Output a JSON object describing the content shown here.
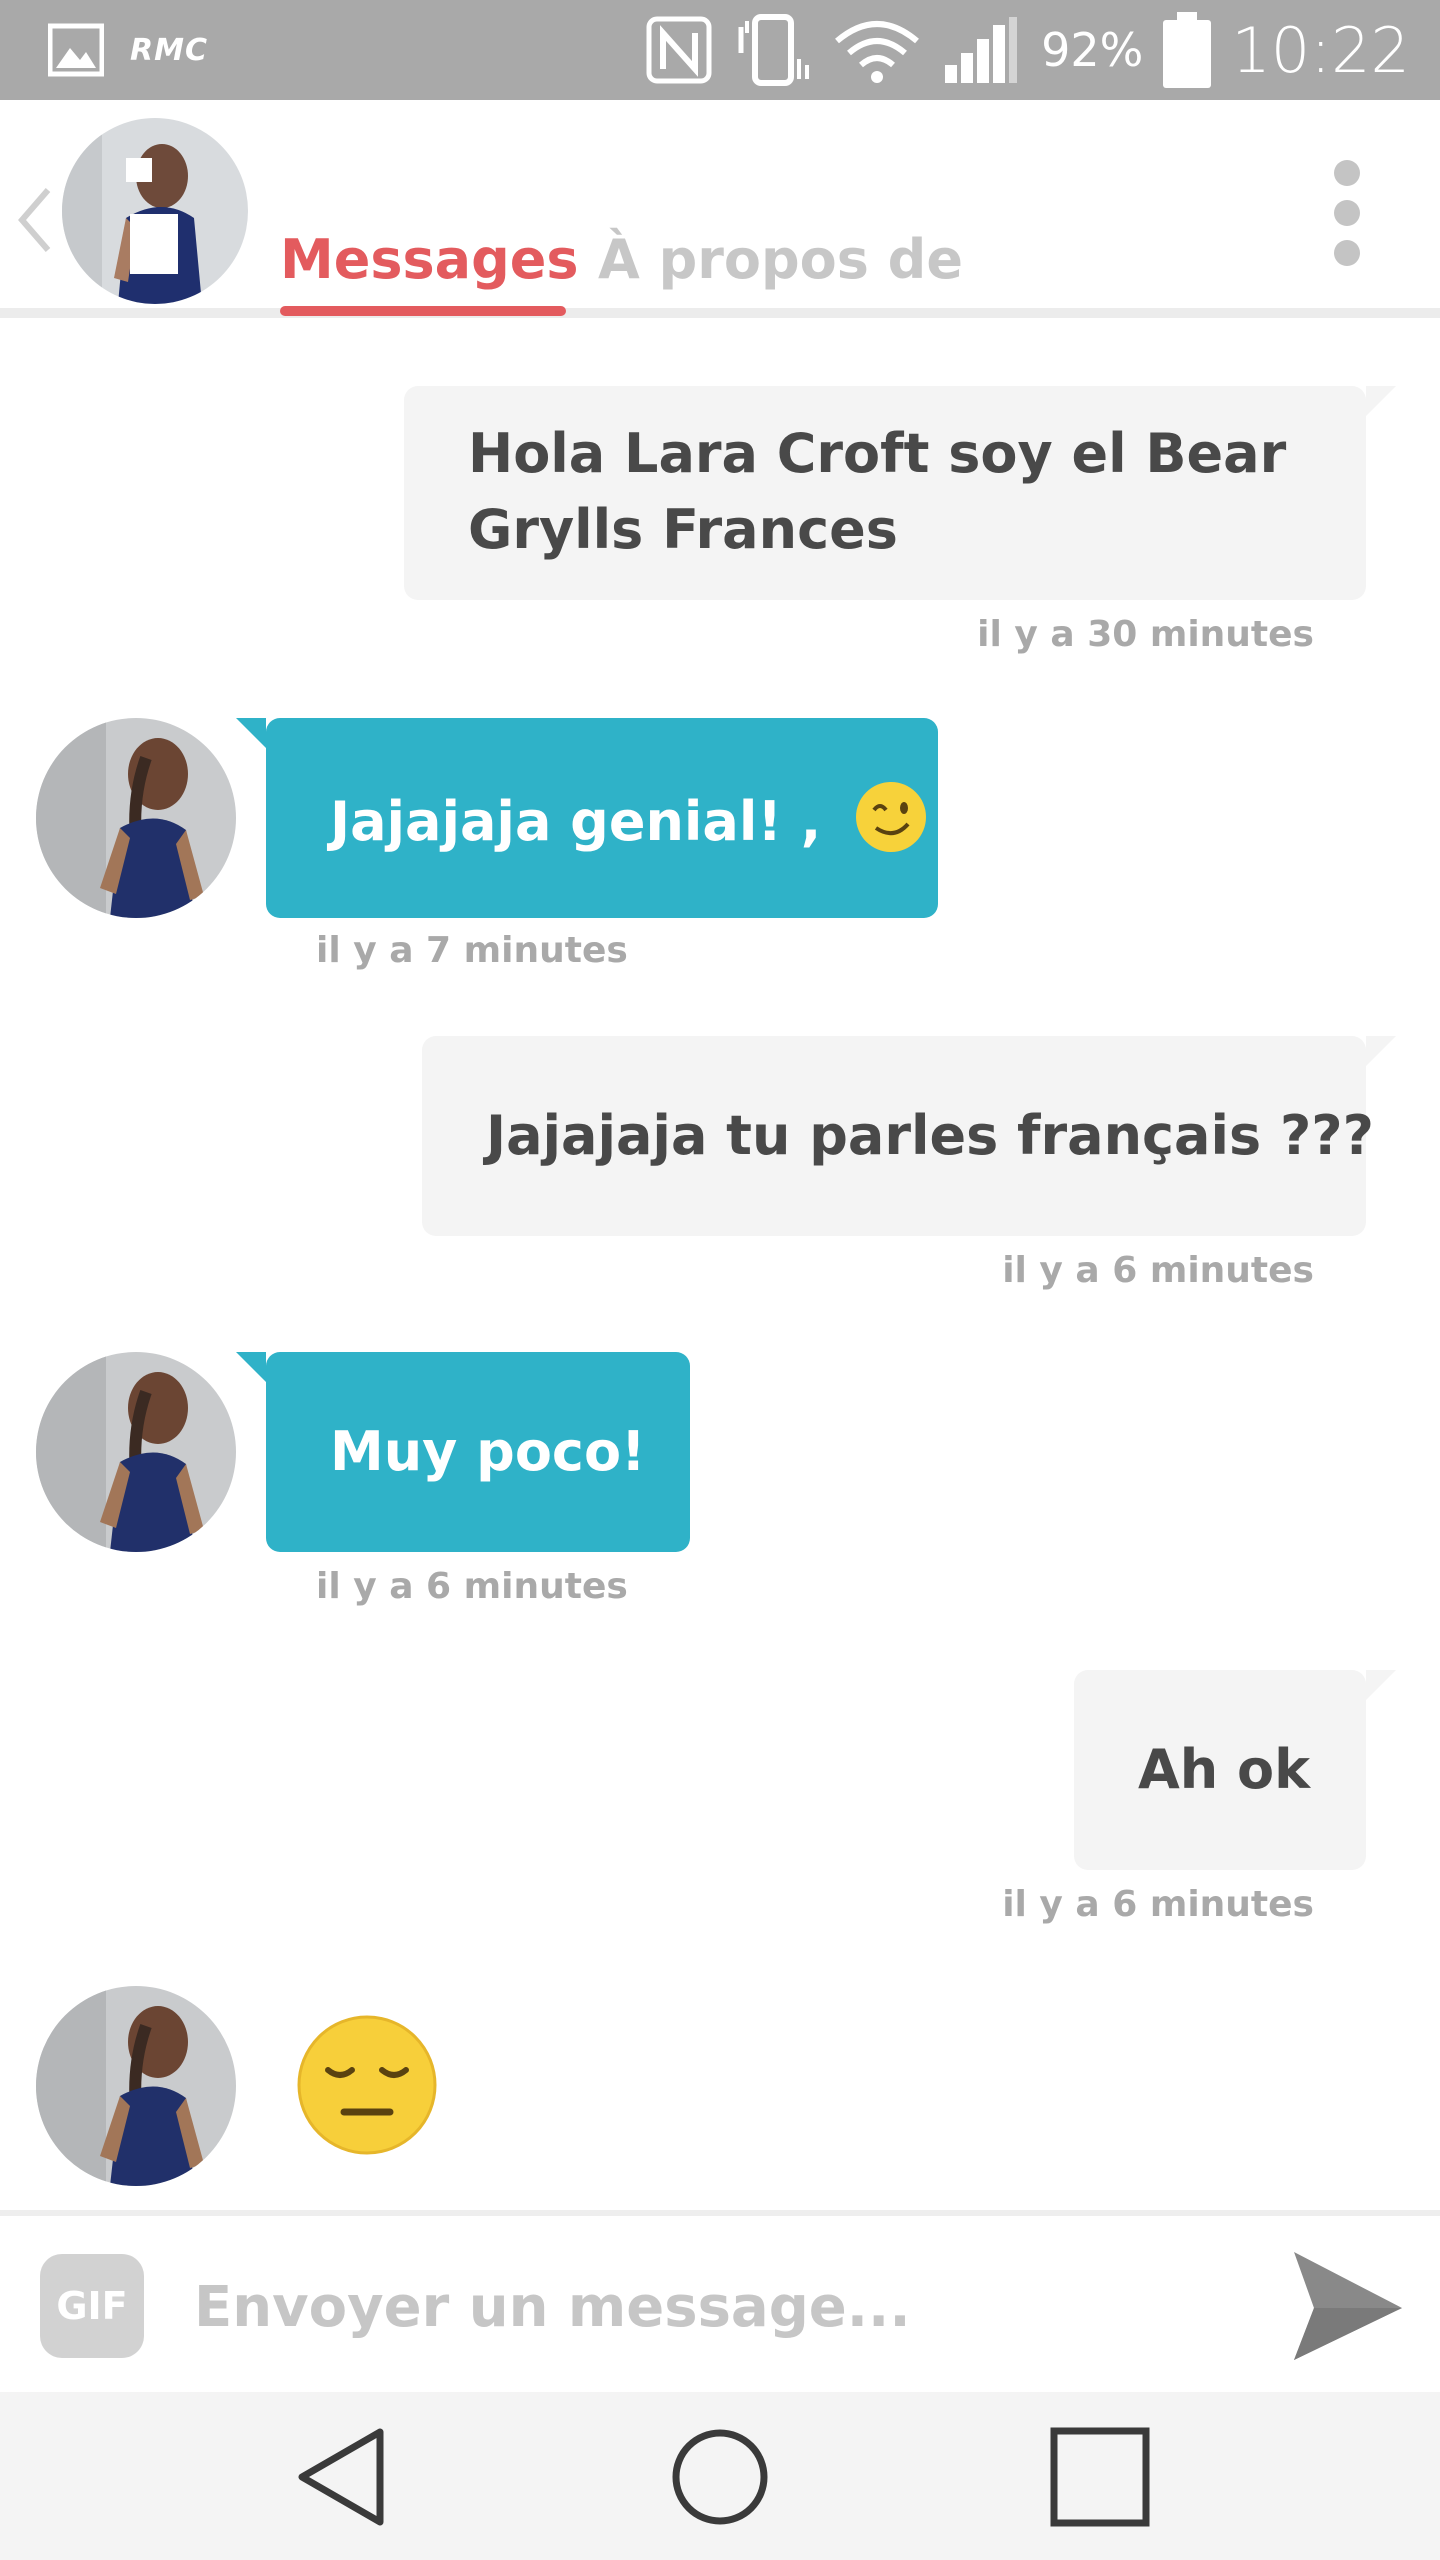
{
  "status_bar": {
    "carrier": "RMC",
    "battery": "92%",
    "time": "10:22",
    "icons": [
      "image-icon",
      "nfc-icon",
      "vibrate-icon",
      "wifi-icon",
      "signal-icon",
      "battery-icon"
    ]
  },
  "header": {
    "tabs": [
      {
        "label": "Messages",
        "active": true
      },
      {
        "label": "À propos de",
        "active": false
      }
    ],
    "accent_color": "#e35b5e",
    "icons": [
      "back-chevron-icon",
      "more-options-icon"
    ]
  },
  "messages": [
    {
      "direction": "outgoing",
      "lines": [
        "Hola Lara Croft soy el Bear",
        "Grylls Frances"
      ],
      "time": "il y a 30 minutes"
    },
    {
      "direction": "incoming",
      "text": "Jajajaja genial! ,",
      "emoji": "winking-face",
      "time": "il y a 7 minutes"
    },
    {
      "direction": "outgoing",
      "text": "Jajajaja tu parles français ???",
      "time": "il y a 6 minutes"
    },
    {
      "direction": "incoming",
      "text": "Muy poco!",
      "time": "il y a 6 minutes"
    },
    {
      "direction": "outgoing",
      "text": "Ah ok",
      "time": "il y a 6 minutes"
    },
    {
      "direction": "incoming",
      "emoji": "relieved-expressionless-face"
    }
  ],
  "colors": {
    "incoming_bubble": "#2fb2c8",
    "outgoing_bubble": "#f4f4f4",
    "timestamp": "#a9a9a9"
  },
  "composer": {
    "gif_label": "GIF",
    "placeholder": "Envoyer un message..."
  },
  "nav_bar": {
    "icons": [
      "back-triangle-icon",
      "home-circle-icon",
      "recents-square-icon"
    ]
  }
}
